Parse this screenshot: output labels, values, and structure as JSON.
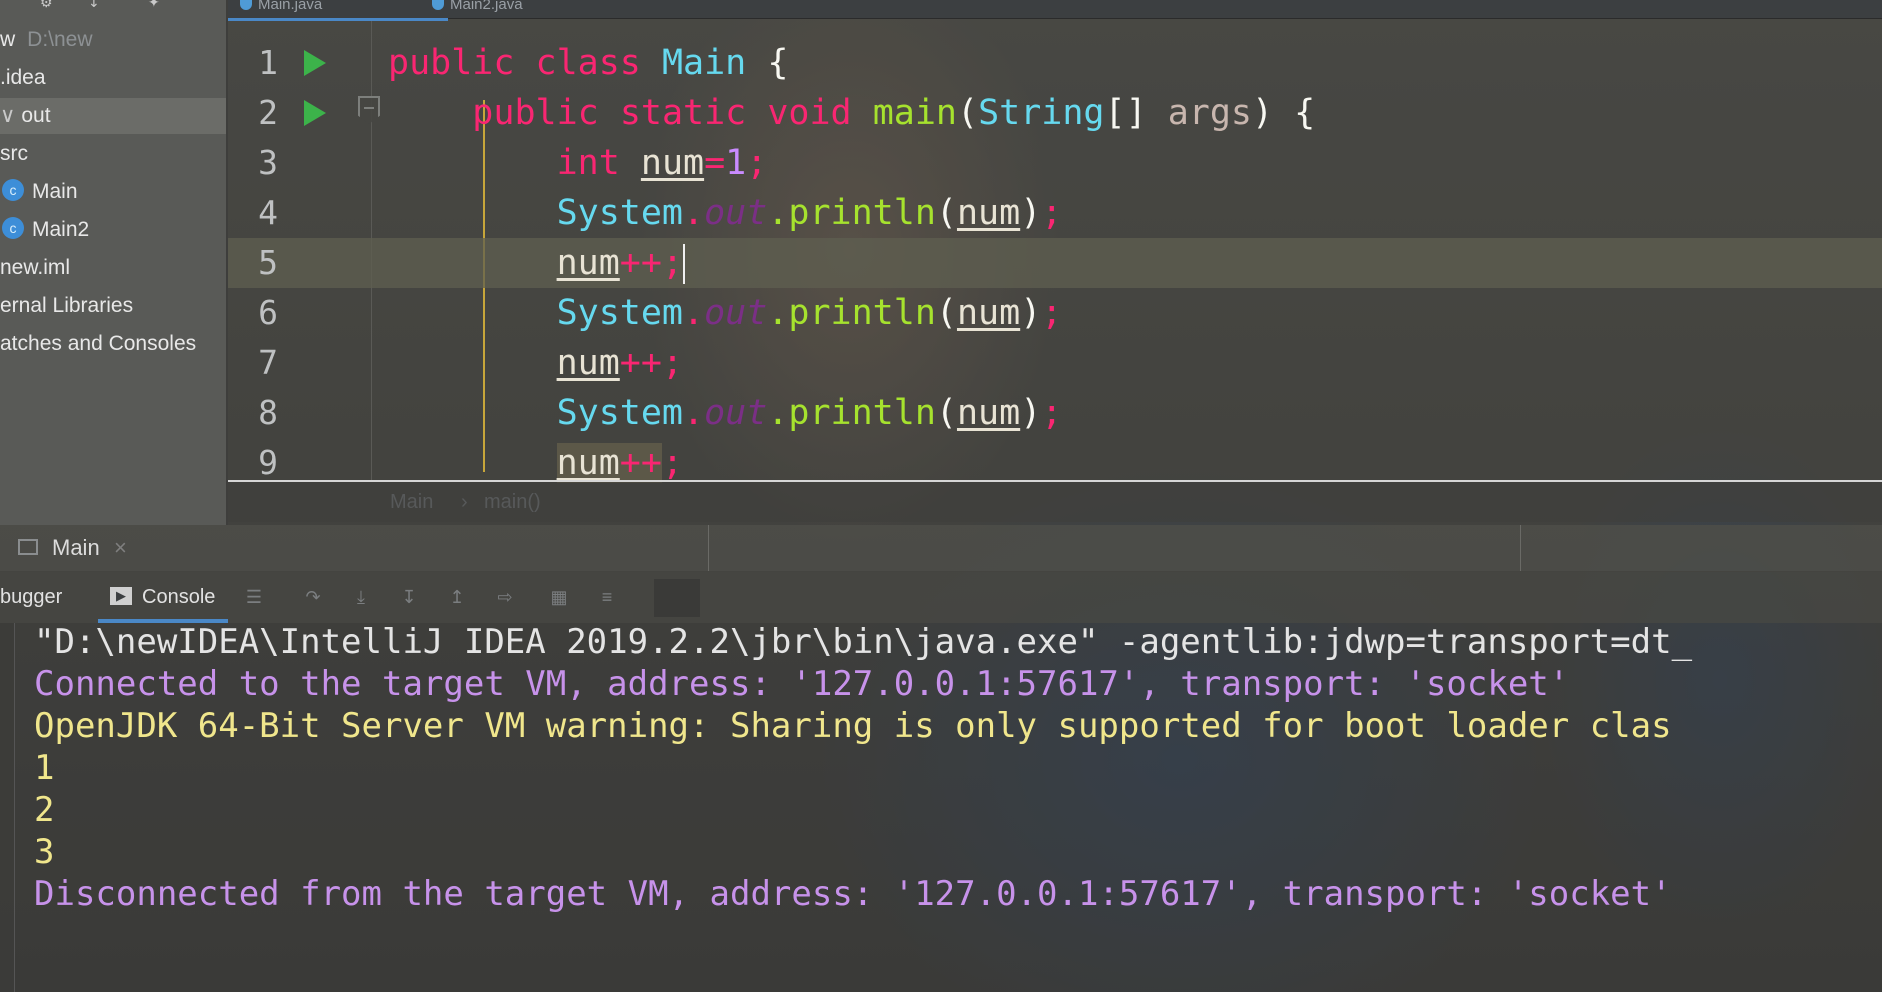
{
  "tabs": [
    {
      "label": "Main.java",
      "active": true
    },
    {
      "label": "Main2.java",
      "active": false
    }
  ],
  "sidebar": {
    "items": [
      {
        "label": "w",
        "suffix": "D:\\new",
        "indent": 0,
        "icon": "project-icon"
      },
      {
        "label": ".idea",
        "indent": 0,
        "icon": "folder-icon"
      },
      {
        "label": "out",
        "prefix": "∨",
        "indent": 0,
        "icon": "folder-icon",
        "selected": true
      },
      {
        "label": "src",
        "indent": 0,
        "icon": "folder-icon"
      },
      {
        "label": "Main",
        "indent": 1,
        "icon": "java-class-icon"
      },
      {
        "label": "Main2",
        "indent": 1,
        "icon": "java-class-icon"
      },
      {
        "label": "new.iml",
        "indent": 0,
        "icon": "file-icon"
      },
      {
        "label": "ernal Libraries",
        "indent": 0,
        "icon": "library-icon"
      },
      {
        "label": "atches and Consoles",
        "indent": 0,
        "icon": "scratch-icon"
      }
    ]
  },
  "editor": {
    "current_line": 5,
    "lines": [
      {
        "n": "1",
        "run": true,
        "tokens": [
          [
            "kw",
            "public "
          ],
          [
            "kw",
            "class "
          ],
          [
            "cls",
            "Main "
          ],
          [
            "punct",
            "{"
          ]
        ]
      },
      {
        "n": "2",
        "run": true,
        "fold": true,
        "tokens": [
          [
            "id",
            "    "
          ],
          [
            "kw",
            "public "
          ],
          [
            "kw",
            "static "
          ],
          [
            "kw",
            "void "
          ],
          [
            "fn",
            "main"
          ],
          [
            "punct",
            "("
          ],
          [
            "cls",
            "String"
          ],
          [
            "punct",
            "[] "
          ],
          [
            "param",
            "args"
          ],
          [
            "punct",
            ") {"
          ]
        ]
      },
      {
        "n": "3",
        "tokens": [
          [
            "id",
            "        "
          ],
          [
            "kw",
            "int "
          ],
          [
            "var",
            "num"
          ],
          [
            "kw",
            "="
          ],
          [
            "num",
            "1"
          ],
          [
            "semi",
            ";"
          ]
        ]
      },
      {
        "n": "4",
        "tokens": [
          [
            "id",
            "        "
          ],
          [
            "cls",
            "System"
          ],
          [
            "semi",
            "."
          ],
          [
            "field",
            "out"
          ],
          [
            "fn",
            ".println"
          ],
          [
            "punct",
            "("
          ],
          [
            "var",
            "num"
          ],
          [
            "punct",
            ")"
          ],
          [
            "semi",
            ";"
          ]
        ]
      },
      {
        "n": "5",
        "caret": true,
        "tokens": [
          [
            "id",
            "        "
          ],
          [
            "var",
            "num"
          ],
          [
            "kw",
            "++"
          ],
          [
            "semi",
            ";"
          ]
        ]
      },
      {
        "n": "6",
        "tokens": [
          [
            "id",
            "        "
          ],
          [
            "cls",
            "System"
          ],
          [
            "semi",
            "."
          ],
          [
            "field",
            "out"
          ],
          [
            "fn",
            ".println"
          ],
          [
            "punct",
            "("
          ],
          [
            "var",
            "num"
          ],
          [
            "punct",
            ")"
          ],
          [
            "semi",
            ";"
          ]
        ]
      },
      {
        "n": "7",
        "tokens": [
          [
            "id",
            "        "
          ],
          [
            "var",
            "num"
          ],
          [
            "kw",
            "++"
          ],
          [
            "semi",
            ";"
          ]
        ]
      },
      {
        "n": "8",
        "tokens": [
          [
            "id",
            "        "
          ],
          [
            "cls",
            "System"
          ],
          [
            "semi",
            "."
          ],
          [
            "field",
            "out"
          ],
          [
            "fn",
            ".println"
          ],
          [
            "punct",
            "("
          ],
          [
            "var",
            "num"
          ],
          [
            "punct",
            ")"
          ],
          [
            "semi",
            ";"
          ]
        ]
      },
      {
        "n": "9",
        "tokens": [
          [
            "id",
            "        "
          ],
          [
            "var",
            "num"
          ],
          [
            "kw",
            "++"
          ],
          [
            "semi",
            ";"
          ]
        ]
      }
    ]
  },
  "breadcrumb": {
    "class": "Main",
    "separator": "›",
    "method": "main()"
  },
  "run_window": {
    "title": "Main",
    "close": "×",
    "tabs": [
      {
        "label": "bugger"
      },
      {
        "label": "Console",
        "active": true
      }
    ]
  },
  "console": {
    "lines": [
      {
        "kind": "c-cmd",
        "text": "\"D:\\newIDEA\\IntelliJ IDEA 2019.2.2\\jbr\\bin\\java.exe\" -agentlib:jdwp=transport=dt_"
      },
      {
        "kind": "c-sys",
        "text": "Connected to the target VM, address: '127.0.0.1:57617', transport: 'socket'"
      },
      {
        "kind": "c-warn",
        "text": "OpenJDK 64-Bit Server VM warning: Sharing is only supported for boot loader clas"
      },
      {
        "kind": "c-out",
        "text": "1"
      },
      {
        "kind": "c-out",
        "text": "2"
      },
      {
        "kind": "c-out",
        "text": "3"
      },
      {
        "kind": "c-sys",
        "text": "Disconnected from the target VM, address: '127.0.0.1:57617', transport: 'socket'"
      }
    ]
  },
  "colors": {
    "keyword": "#f92672",
    "class_name": "#66d9ef",
    "function": "#a6e22e",
    "number": "#c98bff",
    "console_system": "#c792ea",
    "console_output": "#f0e68c",
    "run_gutter": "#3cb34a",
    "tab_accent": "#4a88c7"
  }
}
